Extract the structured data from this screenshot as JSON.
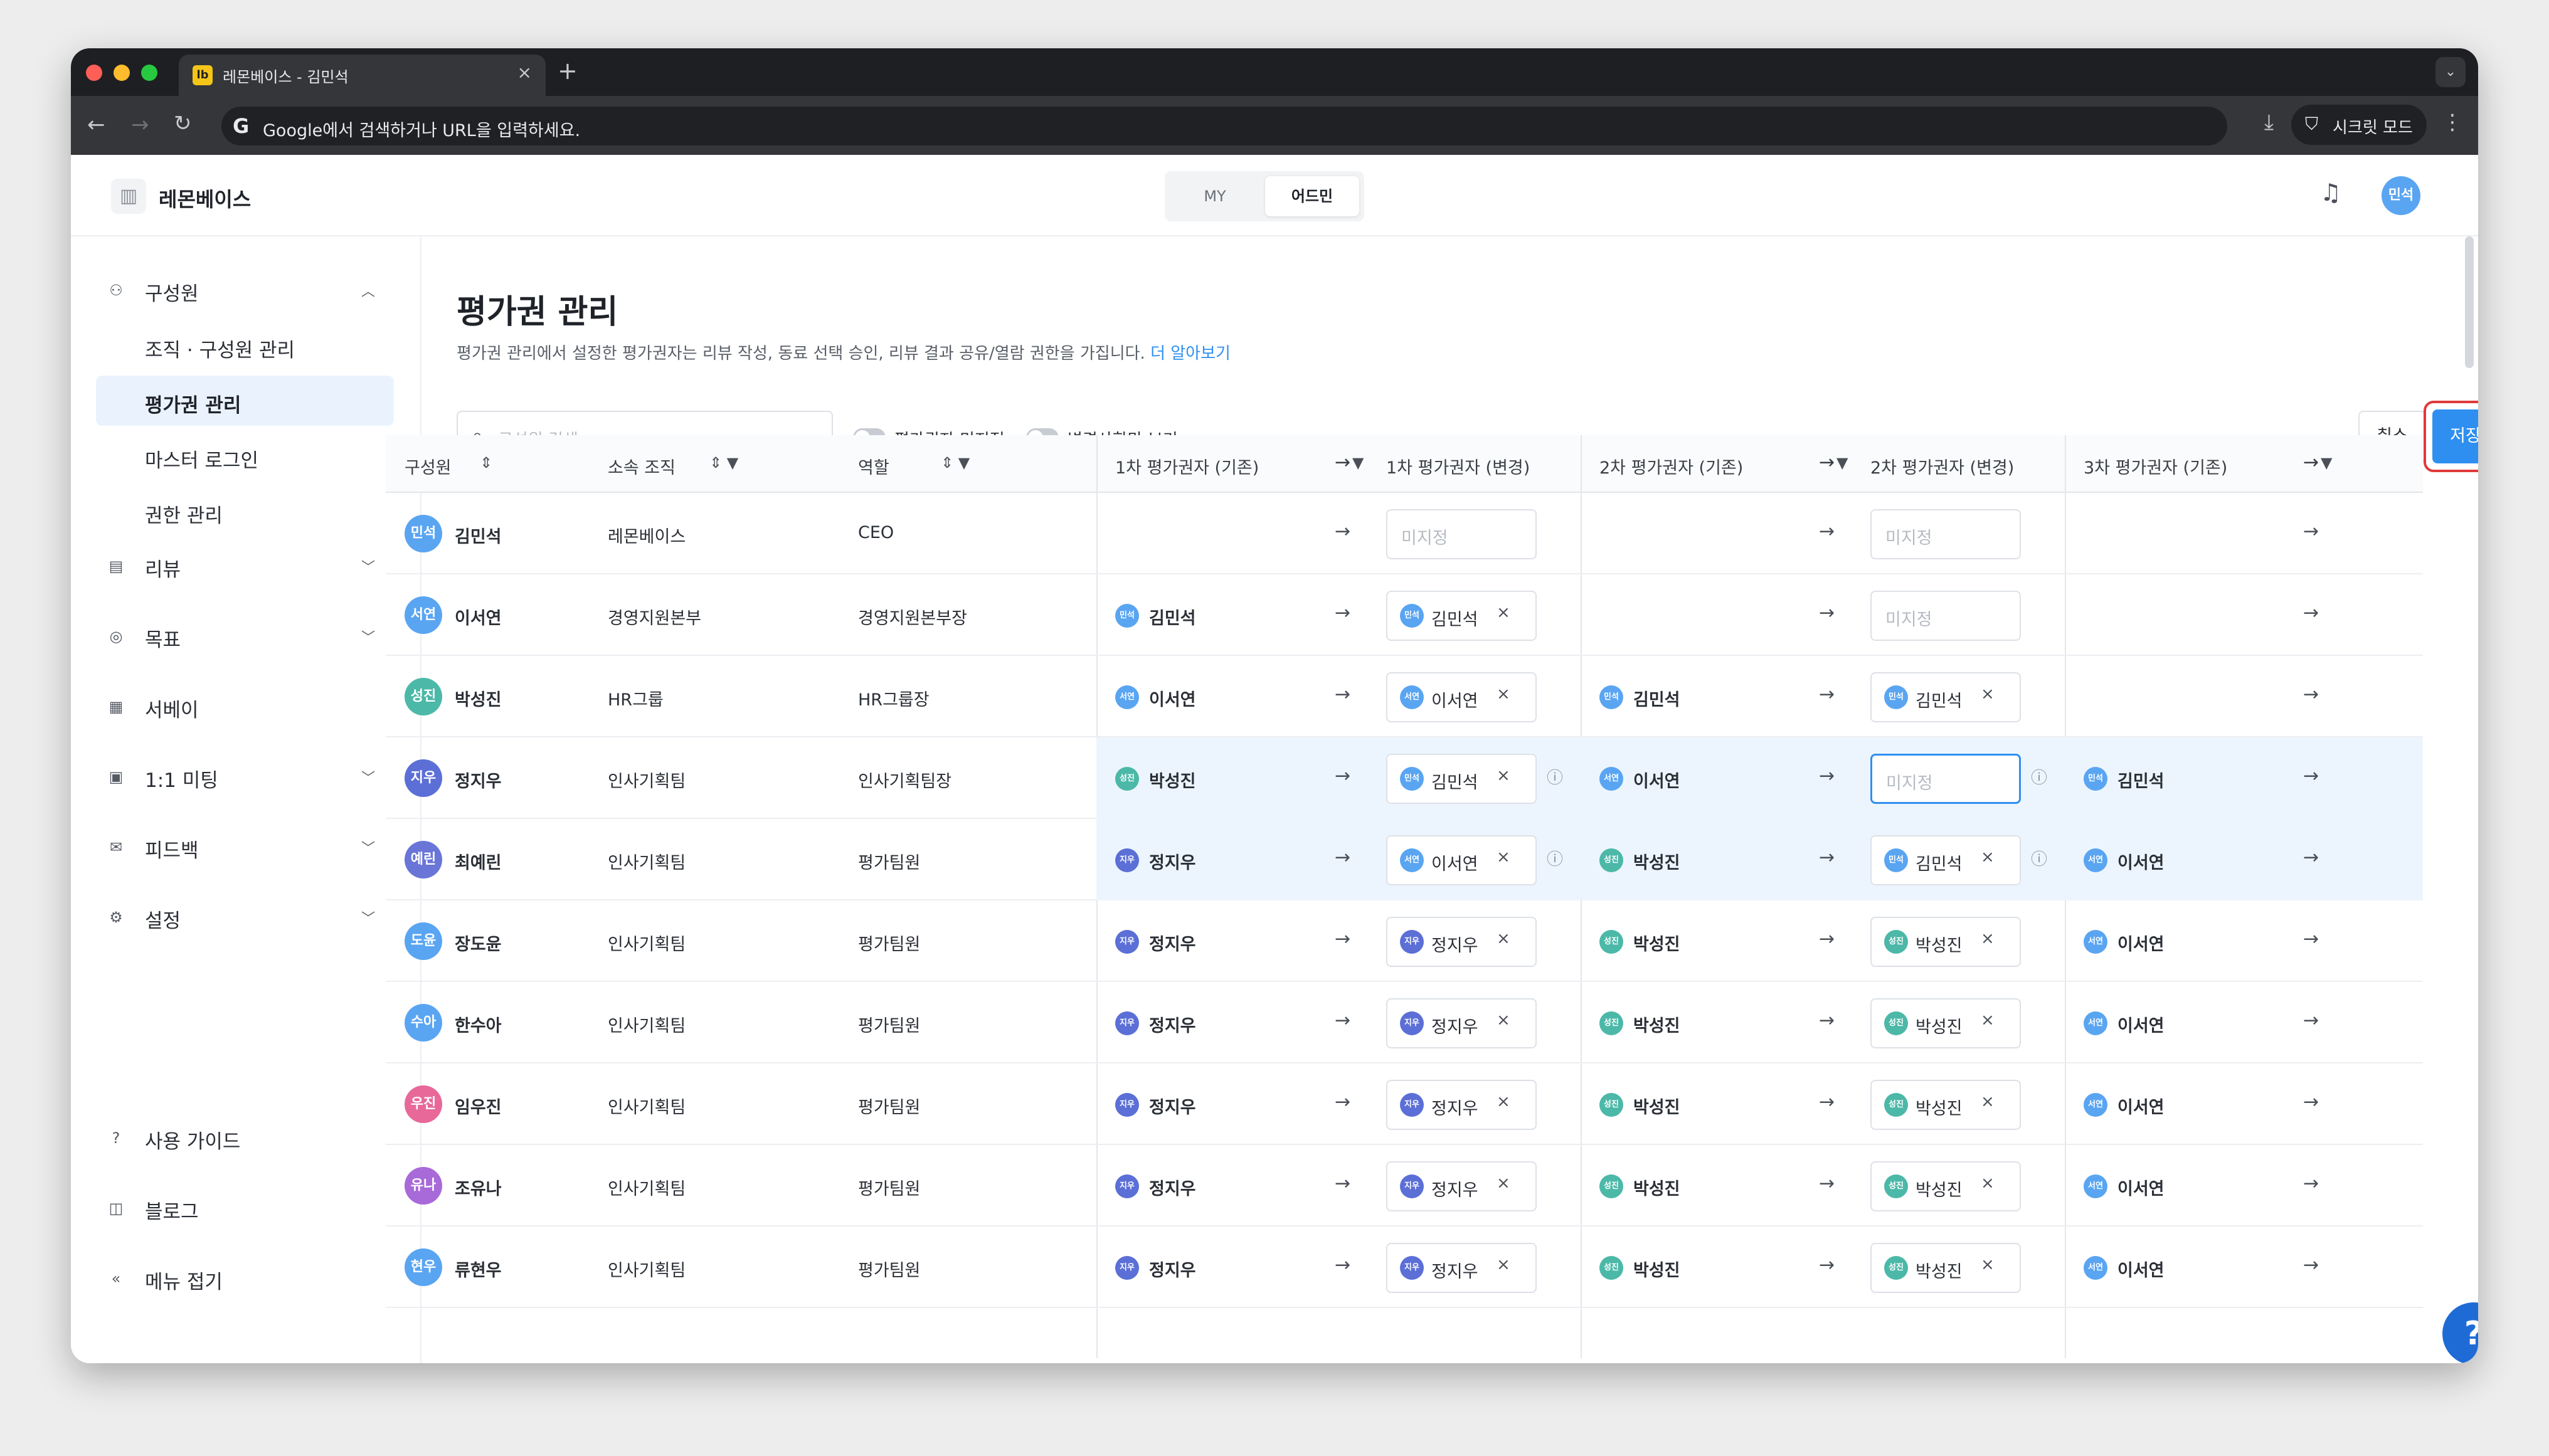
{
  "browser": {
    "tab_title": "레몬베이스 - 김민석",
    "favicon_text": "lb",
    "url_placeholder": "Google에서 검색하거나 URL을 입력하세요.",
    "incognito_label": "시크릿 모드"
  },
  "app": {
    "brand_name": "레몬베이스",
    "mode_tabs": [
      "MY",
      "어드민"
    ],
    "active_mode": "어드민",
    "user_avatar": "민석"
  },
  "sidebar": {
    "sections": [
      {
        "label": "구성원",
        "icon": "person-icon",
        "expanded": true,
        "children": [
          "조직 · 구성원 관리",
          "평가권 관리",
          "마스터 로그인",
          "권한 관리"
        ],
        "active_child": "평가권 관리"
      },
      {
        "label": "리뷰",
        "icon": "document-icon"
      },
      {
        "label": "목표",
        "icon": "target-icon"
      },
      {
        "label": "서베이",
        "icon": "survey-icon"
      },
      {
        "label": "1:1 미팅",
        "icon": "calendar-icon"
      },
      {
        "label": "피드백",
        "icon": "mail-icon"
      },
      {
        "label": "설정",
        "icon": "gear-icon"
      }
    ],
    "footer": [
      {
        "label": "사용 가이드",
        "icon": "help-icon"
      },
      {
        "label": "블로그",
        "icon": "book-icon"
      },
      {
        "label": "메뉴 접기",
        "icon": "collapse-icon"
      }
    ]
  },
  "page": {
    "title": "평가권 관리",
    "description": "평가권 관리에서 설정한 평가권자는 리뷰 작성, 동료 선택 승인, 리뷰 결과 공유/열람 권한을 가집니다.",
    "learn_more": "더 알아보기",
    "search_placeholder": "구성원 검색",
    "toggle_unassigned": "평가권자 미지정",
    "toggle_changes_only": "변경사항만 보기",
    "cancel": "취소",
    "save": "저장"
  },
  "table": {
    "columns": [
      "구성원",
      "소속 조직",
      "역할",
      "1차 평가권자 (기존)",
      "1차 평가권자 (변경)",
      "2차 평가권자 (기존)",
      "2차 평가권자 (변경)",
      "3차 평가권자 (기존)"
    ],
    "unassigned": "미지정",
    "rows": [
      {
        "name": "김민석",
        "initial": "민석",
        "color": "#5aa5f2",
        "org": "레몬베이스",
        "role": "CEO",
        "e1": "",
        "e1c": "",
        "e2": "",
        "e2c": "",
        "e3": ""
      },
      {
        "name": "이서연",
        "initial": "서연",
        "color": "#5aa5f2",
        "org": "경영지원본부",
        "role": "경영지원본부장",
        "e1": "김민석",
        "e1c": "김민석",
        "e2": "",
        "e2c": "",
        "e3": ""
      },
      {
        "name": "박성진",
        "initial": "성진",
        "color": "#4cb8a8",
        "org": "HR그룹",
        "role": "HR그룹장",
        "e1": "이서연",
        "e1c": "이서연",
        "e2": "김민석",
        "e2c": "김민석",
        "e3": ""
      },
      {
        "name": "정지우",
        "initial": "지우",
        "color": "#5b6fd6",
        "org": "인사기획팀",
        "role": "인사기획팀장",
        "e1": "박성진",
        "e1c": "김민석",
        "e2": "이서연",
        "e2c": "",
        "e3": "김민석",
        "highlight": true,
        "focused": true
      },
      {
        "name": "최예린",
        "initial": "예린",
        "color": "#6a75d8",
        "org": "인사기획팀",
        "role": "평가팀원",
        "e1": "정지우",
        "e1c": "이서연",
        "e2": "박성진",
        "e2c": "김민석",
        "e3": "이서연",
        "highlight": true
      },
      {
        "name": "장도윤",
        "initial": "도윤",
        "color": "#5aa5f2",
        "org": "인사기획팀",
        "role": "평가팀원",
        "e1": "정지우",
        "e1c": "정지우",
        "e2": "박성진",
        "e2c": "박성진",
        "e3": "이서연"
      },
      {
        "name": "한수아",
        "initial": "수아",
        "color": "#5aa5f2",
        "org": "인사기획팀",
        "role": "평가팀원",
        "e1": "정지우",
        "e1c": "정지우",
        "e2": "박성진",
        "e2c": "박성진",
        "e3": "이서연"
      },
      {
        "name": "임우진",
        "initial": "우진",
        "color": "#e8689a",
        "org": "인사기획팀",
        "role": "평가팀원",
        "e1": "정지우",
        "e1c": "정지우",
        "e2": "박성진",
        "e2c": "박성진",
        "e3": "이서연"
      },
      {
        "name": "조유나",
        "initial": "유나",
        "color": "#a86ad8",
        "org": "인사기획팀",
        "role": "평가팀원",
        "e1": "정지우",
        "e1c": "정지우",
        "e2": "박성진",
        "e2c": "박성진",
        "e3": "이서연"
      },
      {
        "name": "류현우",
        "initial": "현우",
        "color": "#5aa5f2",
        "org": "인사기획팀",
        "role": "평가팀원",
        "e1": "정지우",
        "e1c": "정지우",
        "e2": "박성진",
        "e2c": "박성진",
        "e3": "이서연"
      }
    ]
  },
  "people_initials": {
    "김민석": "민석",
    "이서연": "서연",
    "박성진": "성진",
    "정지우": "지우"
  },
  "people_colors": {
    "김민석": "#5aa5f2",
    "이서연": "#5aa5f2",
    "박성진": "#4cb8a8",
    "정지우": "#5b6fd6"
  },
  "colors": {
    "accent": "#2f8ff0",
    "highlight_row": "#ecf5fd",
    "save_outline": "#e03a3a"
  }
}
